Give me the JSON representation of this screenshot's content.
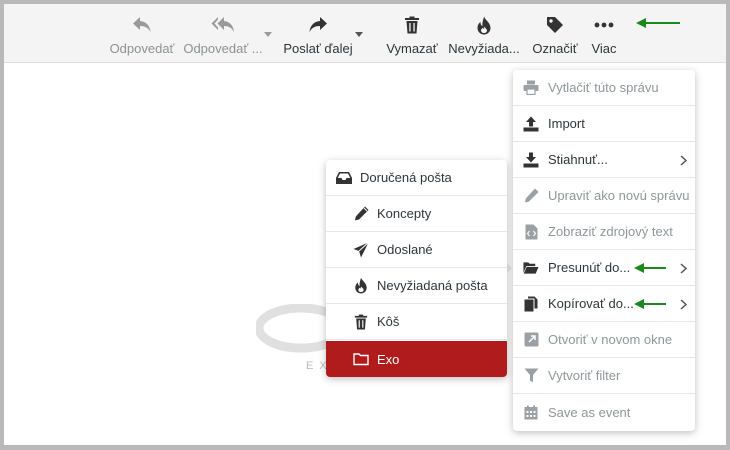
{
  "toolbar": {
    "reply": "Odpovedať",
    "reply_all": "Odpovedať ...",
    "forward": "Poslať ďalej",
    "delete": "Vymazať",
    "junk": "Nevyžiada...",
    "mark": "Označiť",
    "more": "Viac"
  },
  "logo": {
    "sub": "EX"
  },
  "folders": [
    {
      "label": "Doručená pošta",
      "icon": "inbox-icon"
    },
    {
      "label": "Koncepty",
      "icon": "pencil-icon"
    },
    {
      "label": "Odoslané",
      "icon": "send-icon"
    },
    {
      "label": "Nevyžiadaná pošta",
      "icon": "fire-icon"
    },
    {
      "label": "Kôš",
      "icon": "trash-icon"
    },
    {
      "label": "Exo",
      "icon": "folder-icon",
      "active": true
    }
  ],
  "more_menu": [
    {
      "label": "Vytlačiť túto správu",
      "enabled": false,
      "icon": "print-icon"
    },
    {
      "label": "Import",
      "enabled": true,
      "icon": "upload-icon"
    },
    {
      "label": "Stiahnuť...",
      "enabled": true,
      "icon": "download-icon",
      "submenu": true
    },
    {
      "label": "Upraviť ako novú správu",
      "enabled": false,
      "icon": "pencil-icon"
    },
    {
      "label": "Zobraziť zdrojový text",
      "enabled": false,
      "icon": "code-file-icon"
    },
    {
      "label": "Presunúť do...",
      "enabled": true,
      "icon": "folder-open-icon",
      "submenu": true
    },
    {
      "label": "Kopírovať do...",
      "enabled": true,
      "icon": "copy-icon",
      "submenu": true
    },
    {
      "label": "Otvoriť v novom okne",
      "enabled": false,
      "icon": "external-window-icon"
    },
    {
      "label": "Vytvoriť filter",
      "enabled": false,
      "icon": "filter-icon"
    },
    {
      "label": "Save as event",
      "enabled": false,
      "icon": "calendar-icon"
    }
  ],
  "colors": {
    "accent": "#b01c1c",
    "annotation": "#1a8a1a",
    "toolbar_bg": "#f4f4f4"
  }
}
